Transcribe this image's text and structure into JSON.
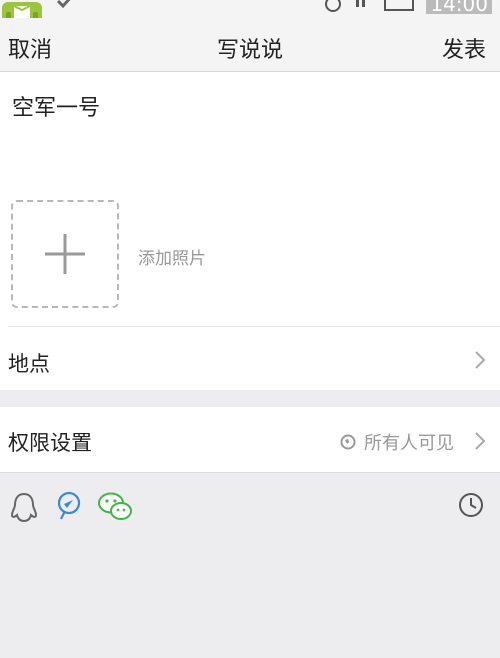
{
  "header": {
    "cancel_label": "取消",
    "title": "写说说",
    "post_label": "发表"
  },
  "compose": {
    "text": "空军一号",
    "add_photo_label": "添加照片"
  },
  "location": {
    "label": "地点"
  },
  "permission": {
    "label": "权限设置",
    "value": "所有人可见"
  },
  "share": {
    "icons": [
      "qq-icon",
      "qzone-icon",
      "wechat-icon",
      "clock-icon"
    ]
  },
  "statusbar": {
    "time": "14:00"
  },
  "colors": {
    "qzone_blue": "#3a8ad6",
    "wechat_green": "#44b549",
    "android_green": "#9bc53d"
  }
}
